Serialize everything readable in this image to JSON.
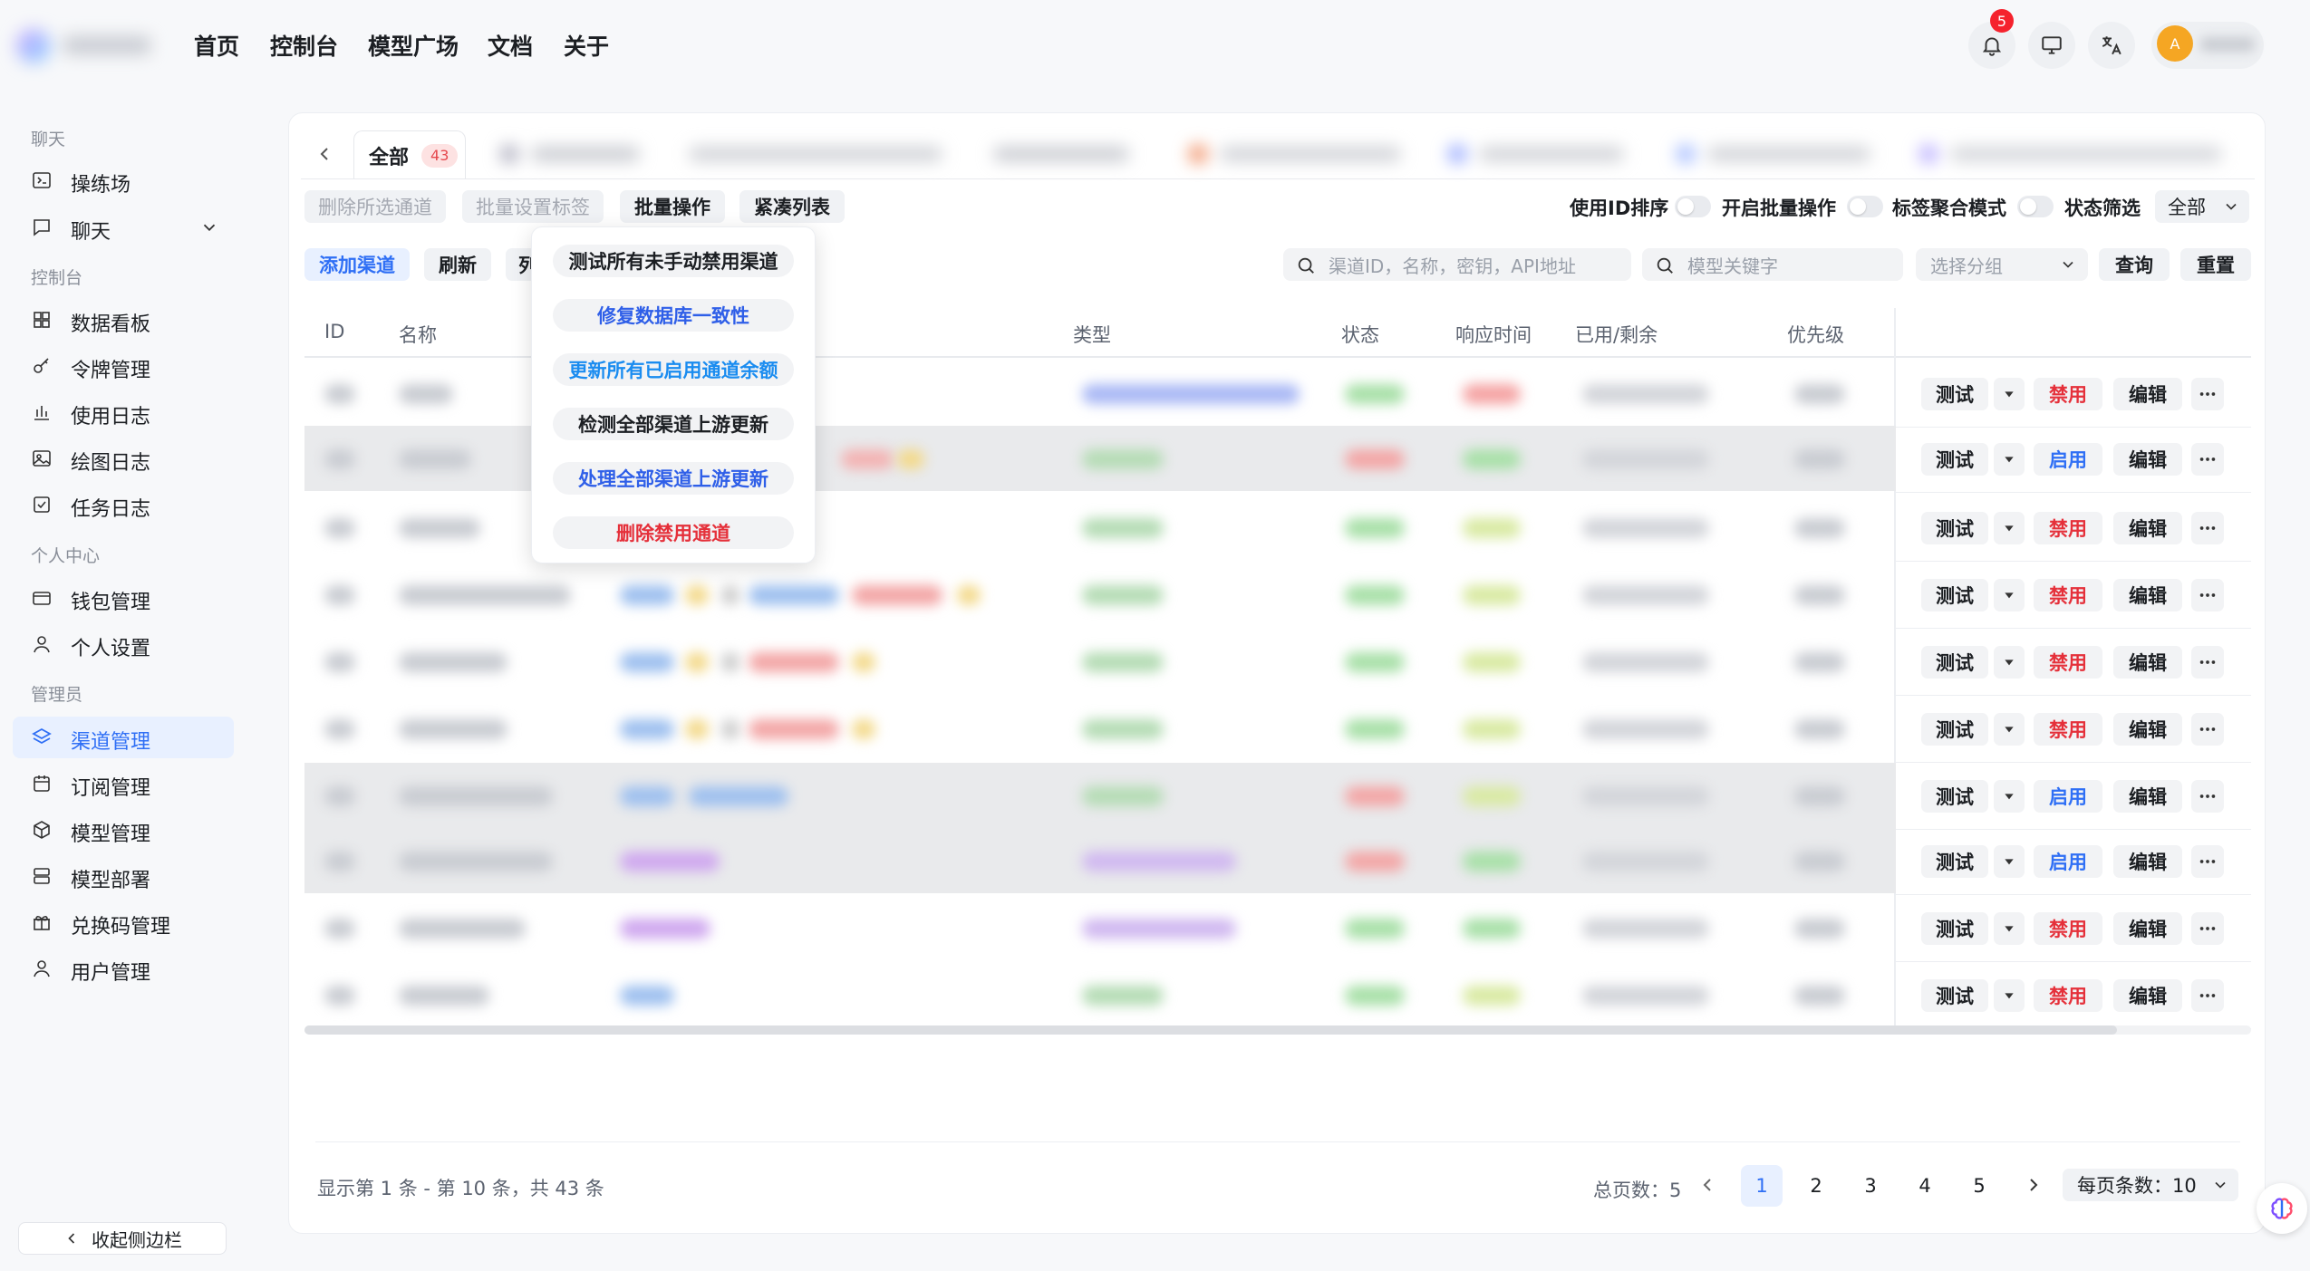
{
  "nav": {
    "home": "首页",
    "console": "控制台",
    "models": "模型广场",
    "docs": "文档",
    "about": "关于"
  },
  "header": {
    "notification_count": "5",
    "avatar_initial": "A"
  },
  "sidebar": {
    "sections": {
      "chat": "聊天",
      "console": "控制台",
      "personal": "个人中心",
      "admin": "管理员"
    },
    "items": [
      {
        "label": "操练场",
        "icon": "playground-icon"
      },
      {
        "label": "聊天",
        "icon": "chat-icon"
      },
      {
        "label": "数据看板",
        "icon": "dashboard-icon"
      },
      {
        "label": "令牌管理",
        "icon": "key-icon"
      },
      {
        "label": "使用日志",
        "icon": "bar-chart-icon"
      },
      {
        "label": "绘图日志",
        "icon": "image-icon"
      },
      {
        "label": "任务日志",
        "icon": "task-icon"
      },
      {
        "label": "钱包管理",
        "icon": "wallet-icon"
      },
      {
        "label": "个人设置",
        "icon": "user-icon"
      },
      {
        "label": "渠道管理",
        "icon": "layers-icon"
      },
      {
        "label": "订阅管理",
        "icon": "calendar-icon"
      },
      {
        "label": "模型管理",
        "icon": "cube-icon"
      },
      {
        "label": "模型部署",
        "icon": "server-icon"
      },
      {
        "label": "兑换码管理",
        "icon": "gift-icon"
      },
      {
        "label": "用户管理",
        "icon": "user-icon"
      }
    ],
    "collapse": "收起侧边栏"
  },
  "tabs": {
    "active_label": "全部",
    "active_count": "43"
  },
  "toolbar": {
    "delete_selected": "删除所选通道",
    "batch_tag": "批量设置标签",
    "batch_ops": "批量操作",
    "compact": "紧凑列表",
    "use_id_sort": "使用ID排序",
    "enable_batch": "开启批量操作",
    "tag_mode": "标签聚合模式",
    "status_filter": "状态筛选",
    "status_value": "全部",
    "add_channel": "添加渠道",
    "refresh": "刷新",
    "col_partial": "列",
    "search_placeholder": "渠道ID，名称，密钥，API地址",
    "model_placeholder": "模型关键字",
    "group_placeholder": "选择分组",
    "query": "查询",
    "reset": "重置"
  },
  "dropdown": [
    {
      "label": "测试所有未手动禁用渠道",
      "color": "#1c1f23"
    },
    {
      "label": "修复数据库一致性",
      "color": "#2f5fe8"
    },
    {
      "label": "更新所有已启用通道余额",
      "color": "#1a8cf0"
    },
    {
      "label": "检测全部渠道上游更新",
      "color": "#1c1f23"
    },
    {
      "label": "处理全部渠道上游更新",
      "color": "#2f5fe8"
    },
    {
      "label": "删除禁用通道",
      "color": "#e5303a"
    }
  ],
  "table": {
    "headers": {
      "id": "ID",
      "name": "名称",
      "type": "类型",
      "status": "状态",
      "response": "响应时间",
      "used": "已用/剩余",
      "priority": "优先级"
    },
    "actions": {
      "test": "测试",
      "disable": "禁用",
      "enable": "启用",
      "edit": "编辑"
    },
    "rows": [
      {
        "action": "禁用"
      },
      {
        "action": "启用"
      },
      {
        "action": "禁用"
      },
      {
        "action": "禁用"
      },
      {
        "action": "禁用"
      },
      {
        "action": "禁用"
      },
      {
        "action": "启用"
      },
      {
        "action": "启用"
      },
      {
        "action": "禁用"
      },
      {
        "action": "禁用"
      }
    ]
  },
  "footer": {
    "summary": "显示第 1 条 - 第 10 条，共 43 条",
    "total_pages": "总页数：5",
    "pages": [
      "1",
      "2",
      "3",
      "4",
      "5"
    ],
    "page_size": "每页条数：10"
  }
}
